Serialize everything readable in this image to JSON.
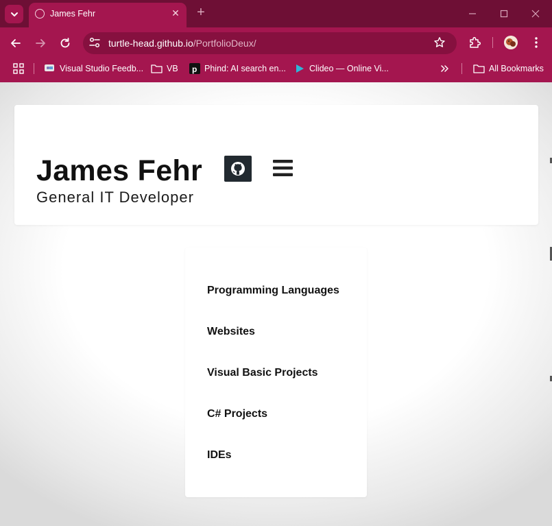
{
  "browser": {
    "tab_title": "James Fehr",
    "url_host": "turtle-head.github.io",
    "url_path": "/PortfolioDeux/",
    "bookmarks": [
      {
        "label": "Visual Studio Feedb...",
        "icon": "feedback-icon"
      },
      {
        "label": "VB",
        "icon": "folder-icon"
      },
      {
        "label": "Phind: AI search en...",
        "icon": "phind-icon"
      },
      {
        "label": "Clideo — Online Vi...",
        "icon": "clideo-icon"
      }
    ],
    "all_bookmarks_label": "All Bookmarks",
    "colors": {
      "frame": "#6e0f35",
      "toolbar": "#a4164f"
    }
  },
  "page": {
    "name": "James Fehr",
    "subtitle": "General IT Developer",
    "nav_items": [
      "Programming Languages",
      "Websites",
      "Visual Basic Projects",
      "C# Projects",
      "IDEs"
    ],
    "icons": {
      "github": "github-icon",
      "menu": "hamburger-menu-icon"
    }
  }
}
